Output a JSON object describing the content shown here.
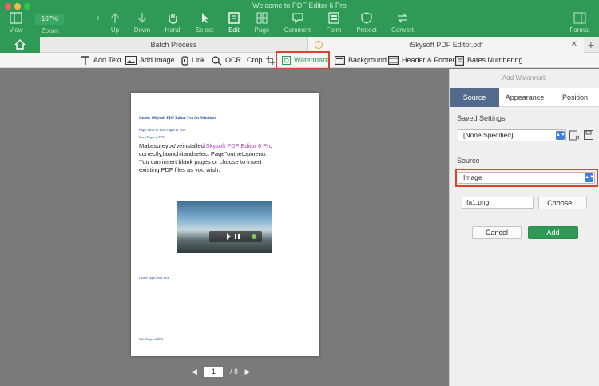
{
  "window": {
    "title": "Welcome to PDF Editor 6 Pro"
  },
  "toolbar_top": {
    "view": "View",
    "zoom_value": "107%",
    "zoom_label": "Zoom",
    "up": "Up",
    "down": "Down",
    "hand": "Hand",
    "select": "Select",
    "edit": "Edit",
    "page": "Page",
    "comment": "Comment",
    "form": "Form",
    "protect": "Protect",
    "convert": "Convert",
    "format": "Format"
  },
  "tabs": {
    "batch": "Batch Process",
    "doc": "iSkysoft PDF Editor.pdf",
    "plus": "+"
  },
  "edit_toolbar": {
    "add_text": "Add Text",
    "add_image": "Add Image",
    "link": "Link",
    "ocr": "OCR",
    "crop": "Crop",
    "watermark": "Watermark",
    "background": "Background",
    "header_footer": "Header & Footer",
    "bates": "Bates Numbering"
  },
  "document": {
    "heading": "Guide: iSkysoft PDF Editor Pro for Windows",
    "sub1": "Page: How to Edit Pages in PDF",
    "sub2": "Insert Pages in PDF",
    "big1": "Makesureyou'veinstalled",
    "big_pink": "iSkysoft PDF Editor 6 Pro",
    "big2": "correctly,launchitandselect Page\"onthetopmenu.",
    "big3": "You can insert blank pages or choose to insert",
    "big4": "existing PDF files as you wish.",
    "sub3": "Delete Pages from PDF",
    "sub4": "Split Pages in PDF",
    "page_current": "1",
    "page_total": "/ 8"
  },
  "panel": {
    "title": "Add Watermark",
    "tab_source": "Source",
    "tab_appearance": "Appearance",
    "tab_position": "Position",
    "saved_settings_label": "Saved Settings",
    "saved_settings_value": "[None Specified]",
    "source_label": "Source",
    "source_value": "Image",
    "file_value": "fa1.png",
    "choose": "Choose...",
    "cancel": "Cancel",
    "add": "Add"
  },
  "colors": {
    "brand": "#2f9a55",
    "highlight": "#d9452c",
    "selected_tab": "#546a8c"
  }
}
